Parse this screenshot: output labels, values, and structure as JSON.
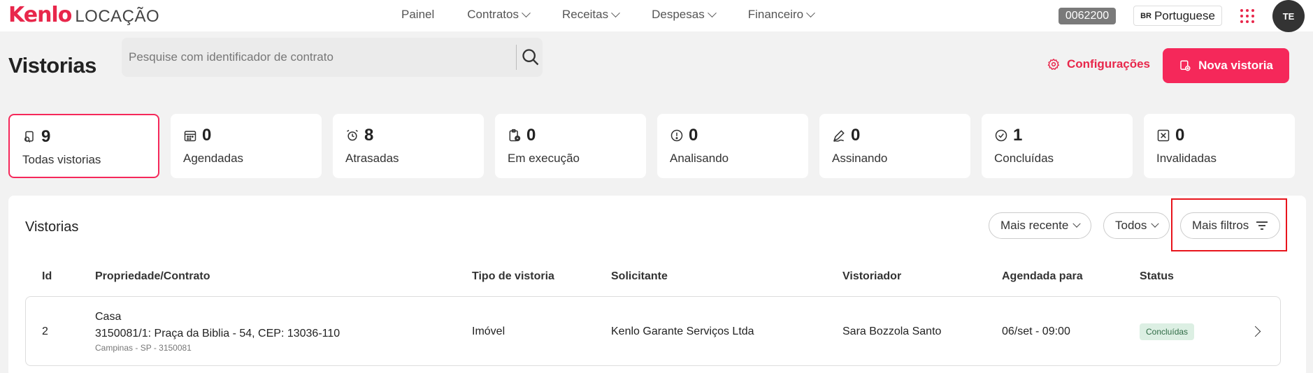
{
  "app": {
    "brand": "Kenlo",
    "product": "LOCAÇÃO"
  },
  "nav": [
    {
      "label": "Painel",
      "dropdown": false
    },
    {
      "label": "Contratos",
      "dropdown": true
    },
    {
      "label": "Receitas",
      "dropdown": true
    },
    {
      "label": "Despesas",
      "dropdown": true
    },
    {
      "label": "Financeiro",
      "dropdown": true
    }
  ],
  "account": {
    "code": "0062200",
    "language_flag": "BR",
    "language": "Portuguese",
    "avatar_initials": "TE"
  },
  "header": {
    "title": "Vistorias",
    "search_placeholder": "Pesquise com identificador de contrato",
    "config_label": "Configurações",
    "new_button_label": "Nova vistoria"
  },
  "status_cards": [
    {
      "icon": "search-document-icon",
      "count": "9",
      "label": "Todas vistorias",
      "active": true
    },
    {
      "icon": "calendar-icon",
      "count": "0",
      "label": "Agendadas",
      "active": false
    },
    {
      "icon": "alarm-clock-icon",
      "count": "8",
      "label": "Atrasadas",
      "active": false
    },
    {
      "icon": "clipboard-play-icon",
      "count": "0",
      "label": "Em execução",
      "active": false
    },
    {
      "icon": "alert-circle-icon",
      "count": "0",
      "label": "Analisando",
      "active": false
    },
    {
      "icon": "signature-pen-icon",
      "count": "0",
      "label": "Assinando",
      "active": false
    },
    {
      "icon": "check-circle-icon",
      "count": "1",
      "label": "Concluídas",
      "active": false
    },
    {
      "icon": "x-square-icon",
      "count": "0",
      "label": "Invalidadas",
      "active": false
    }
  ],
  "list": {
    "title": "Vistorias",
    "sort_label": "Mais recente",
    "type_filter_label": "Todos",
    "more_filters_label": "Mais filtros",
    "columns": [
      "Id",
      "Propriedade/Contrato",
      "Tipo de vistoria",
      "Solicitante",
      "Vistoriador",
      "Agendada para",
      "Status"
    ],
    "rows": [
      {
        "id": "2",
        "property": "Casa",
        "contract": "3150081/1: Praça da Biblia - 54, CEP: 13036-110",
        "location": "Campinas - SP - 3150081",
        "type": "Imóvel",
        "requester": "Kenlo Garante Serviços Ltda",
        "inspector": "Sara Bozzola Santo",
        "scheduled": "06/set - 09:00",
        "status": "Concluídas"
      }
    ]
  },
  "colors": {
    "accent": "#f5285a",
    "brand": "#e8274b",
    "status_done_bg": "#dcefe3",
    "highlight": "#e8141c"
  }
}
